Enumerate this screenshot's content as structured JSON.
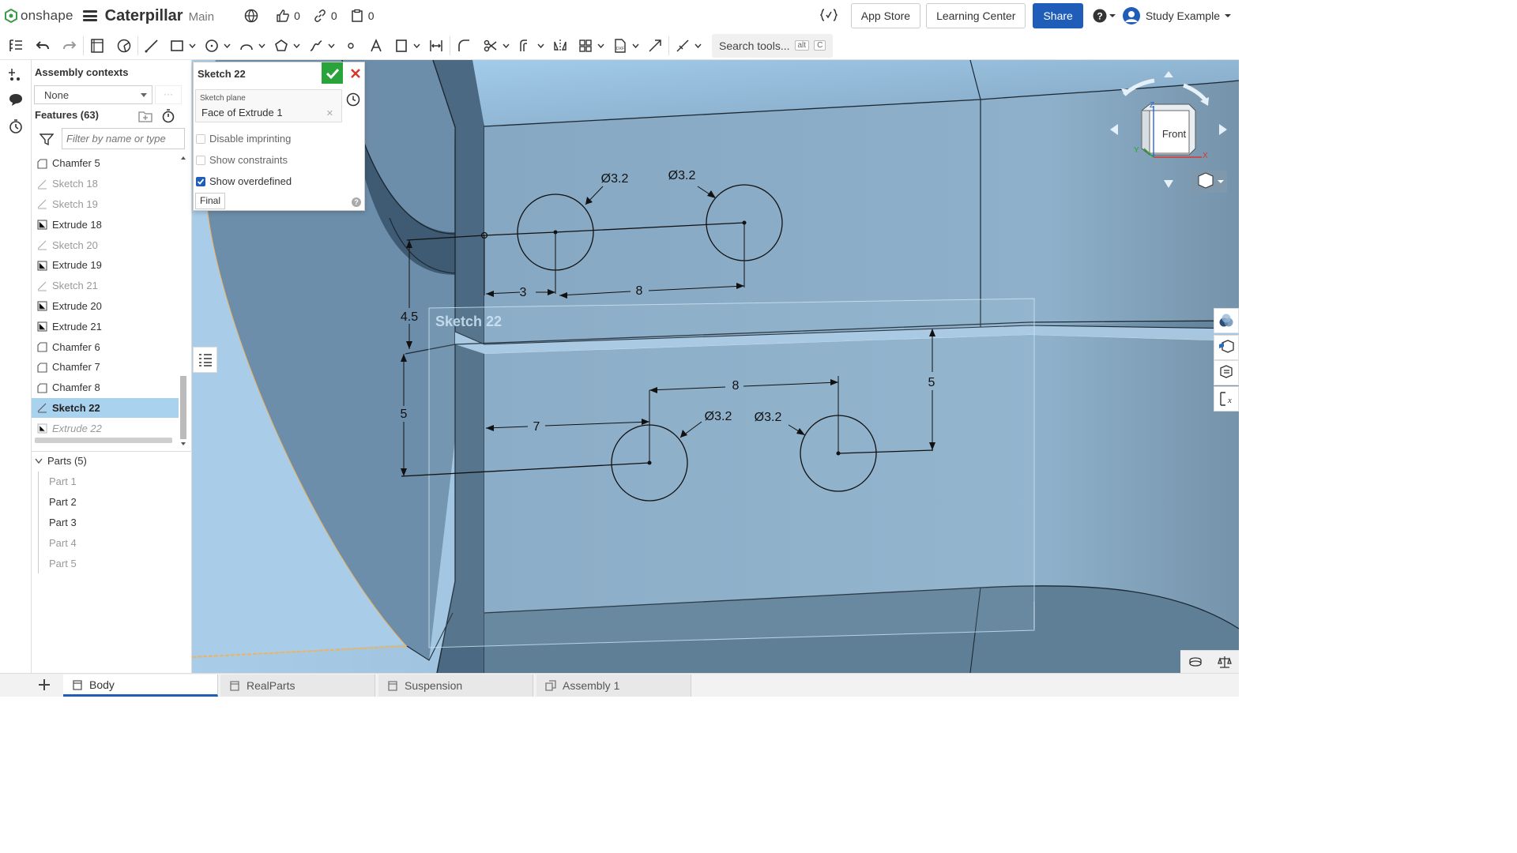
{
  "app": {
    "brand": "onshape",
    "doc_title": "Caterpillar",
    "branch": "Main"
  },
  "topbar": {
    "likes": "0",
    "links": "0",
    "copies": "0",
    "app_store": "App Store",
    "learning_center": "Learning Center",
    "share": "Share",
    "user": "Study Example"
  },
  "toolbar": {
    "search_label": "Search tools...",
    "shortcut_alt": "alt",
    "shortcut_key": "C"
  },
  "assembly": {
    "label": "Assembly contexts",
    "value": "None",
    "more": "···"
  },
  "features": {
    "label": "Features (63)",
    "filter_placeholder": "Filter by name or type",
    "items": [
      {
        "label": "Chamfer 5",
        "kind": "chamfer"
      },
      {
        "label": "Sketch 18",
        "kind": "sketch"
      },
      {
        "label": "Sketch 19",
        "kind": "sketch"
      },
      {
        "label": "Extrude 18",
        "kind": "extrude"
      },
      {
        "label": "Sketch 20",
        "kind": "sketch"
      },
      {
        "label": "Extrude 19",
        "kind": "extrude"
      },
      {
        "label": "Sketch 21",
        "kind": "sketch"
      },
      {
        "label": "Extrude 20",
        "kind": "extrude"
      },
      {
        "label": "Extrude 21",
        "kind": "extrude"
      },
      {
        "label": "Chamfer 6",
        "kind": "chamfer"
      },
      {
        "label": "Chamfer 7",
        "kind": "chamfer"
      },
      {
        "label": "Chamfer 8",
        "kind": "chamfer"
      },
      {
        "label": "Sketch 22",
        "kind": "sketch"
      },
      {
        "label": "Extrude 22",
        "kind": "extrude"
      }
    ]
  },
  "parts": {
    "label": "Parts (5)",
    "items": [
      "Part 1",
      "Part 2",
      "Part 3",
      "Part 4",
      "Part 5"
    ]
  },
  "sketch_dialog": {
    "title": "Sketch 22",
    "plane_label": "Sketch plane",
    "plane_value": "Face of Extrude 1",
    "opt_imprint": "Disable imprinting",
    "opt_constraints": "Show constraints",
    "opt_overdefined": "Show overdefined",
    "final": "Final",
    "help": "?"
  },
  "viewport": {
    "sketch_label": "Sketch 22",
    "view_cube_face": "Front",
    "dims": {
      "d1": "Ø3.2",
      "d2": "Ø3.2",
      "d3": "Ø3.2",
      "d4": "Ø3.2",
      "h3": "3",
      "h8top": "8",
      "v45": "4.5",
      "v5left": "5",
      "h7": "7",
      "h8bot": "8",
      "v5right": "5"
    }
  },
  "tabs": [
    "Body",
    "RealParts",
    "Suspension",
    "Assembly 1"
  ],
  "colors": {
    "accent": "#1f5db8",
    "ok": "#2aa33b",
    "cancel": "#d9342b",
    "selection": "#a9d2ef"
  }
}
